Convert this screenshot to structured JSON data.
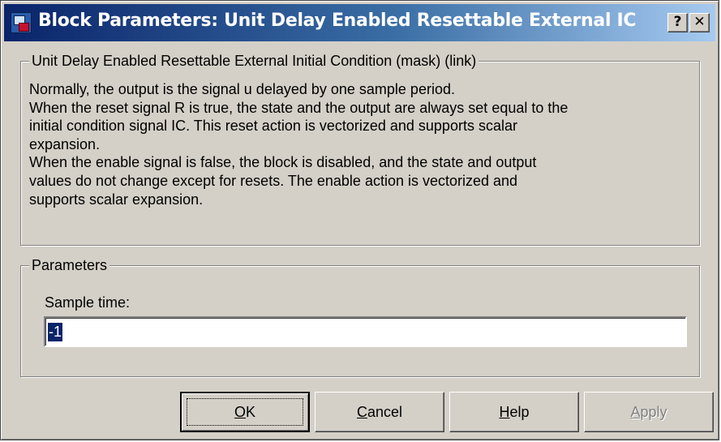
{
  "window": {
    "title": "Block Parameters: Unit Delay Enabled Resettable External IC",
    "help_button": "?",
    "close_button": "✕"
  },
  "description": {
    "group_title": "Unit Delay Enabled Resettable External Initial Condition (mask) (link)",
    "lines": [
      "Normally, the output is the signal u delayed by one sample period.",
      "When the reset signal R is true, the state and the output are always set equal to the",
      "initial condition signal IC.  This reset action is vectorized and supports scalar",
      "expansion.",
      "When the enable signal is false, the block is disabled, and the state and output",
      "values do not change except for resets.  The enable action is vectorized and",
      "supports scalar expansion."
    ]
  },
  "parameters": {
    "group_title": "Parameters",
    "sample_time": {
      "label": "Sample time:",
      "value": "-1"
    }
  },
  "buttons": {
    "ok": {
      "label": "OK",
      "mnemonic_prefix": "",
      "mnemonic": "O",
      "rest": "K"
    },
    "cancel": {
      "label": "Cancel",
      "mnemonic": "C",
      "rest": "ancel"
    },
    "help": {
      "label": "Help",
      "mnemonic": "H",
      "rest": "elp"
    },
    "apply": {
      "label": "Apply",
      "mnemonic": "A",
      "rest": "pply",
      "enabled": false
    }
  },
  "colors": {
    "titlebar_start": "#0a246a",
    "titlebar_end": "#a6caf0",
    "dialog_face": "#d4d0c8",
    "selection": "#0a246a"
  }
}
